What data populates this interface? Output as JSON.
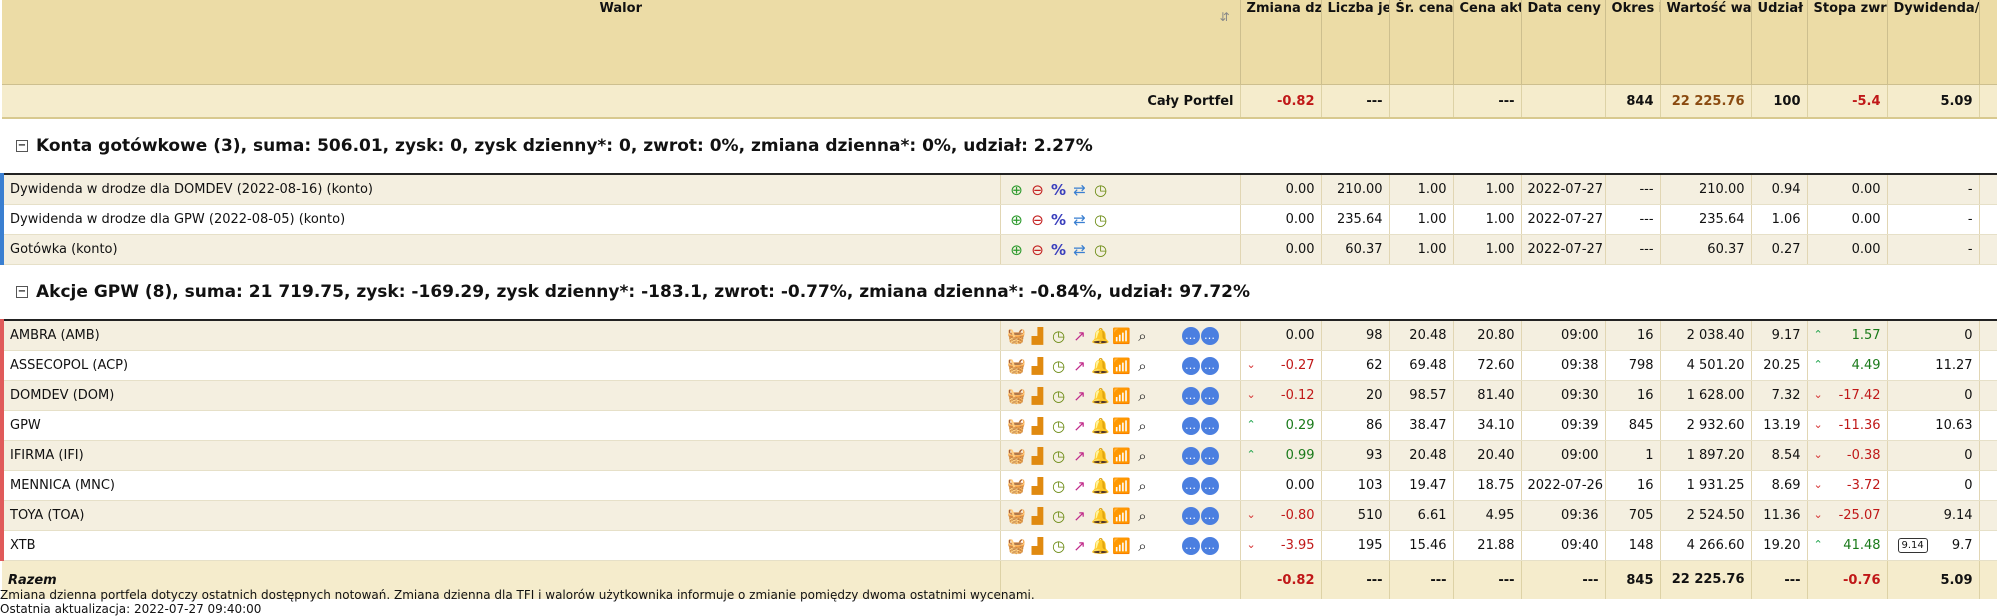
{
  "headers": {
    "walor": "Walor",
    "sort_icon": "⇵",
    "zmiana": "Zmiana dzienna* [%]",
    "liczba": "Liczba jednostek",
    "sr_cena": "Śr. cena zakupu [PLN]",
    "cena_akt": "Cena aktualna [PLN]",
    "data_ceny": "Data ceny aktualnej ***",
    "okres": "Okres inwest. [dni]",
    "wartosc": "Wartość waloru [PLN]",
    "udzial": "Udział waloru [%]",
    "stopa": "Stopa zwrotu [%]",
    "dywidenda": "Dywidenda/ odsetki do ceny zakupu [%]"
  },
  "total": {
    "label": "Cały Portfel",
    "zmiana": "-0.82",
    "liczba": "---",
    "sr_cena": "",
    "cena": "---",
    "data": "",
    "okres": "844",
    "wartosc": "22 225.76",
    "udzial": "100",
    "stopa": "-5.4",
    "dywid": "5.09"
  },
  "sections": {
    "cash": {
      "title": "Konta gotówkowe (3), suma: 506.01, zysk: 0, zysk dzienny*: 0, zwrot: 0%, zmiana dzienna*: 0%, udział: 2.27%",
      "toggle": "−"
    },
    "gpw": {
      "title": "Akcje GPW (8), suma: 21 719.75, zysk: -169.29, zysk dzienny*: -183.1, zwrot: -0.77%, zmiana dzienna*: -0.84%, udział: 97.72%",
      "toggle": "−"
    }
  },
  "cash_rows": [
    {
      "name": "Dywidenda w drodze dla DOMDEV (2022-08-16) (konto)",
      "zmiana": "0.00",
      "liczba": "210.00",
      "sr": "1.00",
      "cena": "1.00",
      "data": "2022-07-27",
      "okres": "---",
      "wartosc": "210.00",
      "udzial": "0.94",
      "stopa": "0.00",
      "dywid": "-"
    },
    {
      "name": "Dywidenda w drodze dla GPW (2022-08-05) (konto)",
      "zmiana": "0.00",
      "liczba": "235.64",
      "sr": "1.00",
      "cena": "1.00",
      "data": "2022-07-27",
      "okres": "---",
      "wartosc": "235.64",
      "udzial": "1.06",
      "stopa": "0.00",
      "dywid": "-"
    },
    {
      "name": "Gotówka (konto)",
      "zmiana": "0.00",
      "liczba": "60.37",
      "sr": "1.00",
      "cena": "1.00",
      "data": "2022-07-27",
      "okres": "---",
      "wartosc": "60.37",
      "udzial": "0.27",
      "stopa": "0.00",
      "dywid": "-"
    }
  ],
  "cash_icons": {
    "add": "⊕",
    "remove": "⊖",
    "pct": "%",
    "transfer": "⇄",
    "clock": "◷"
  },
  "stock_icons": {
    "basket": "🧺",
    "bars": "▟",
    "clock": "◷",
    "trend": "↗",
    "alert": "🔔",
    "signal": "📶",
    "search": "⌕",
    "msg1": "…",
    "msg2": "…"
  },
  "stock_rows": [
    {
      "name": "AMBRA (AMB)",
      "zdir": "",
      "zmiana": "0.00",
      "liczba": "98",
      "sr": "20.48",
      "cena": "20.80",
      "data": "09:00",
      "okres": "16",
      "wartosc": "2 038.40",
      "udzial": "9.17",
      "sdir": "up",
      "stopa": "1.57",
      "dywid": "0"
    },
    {
      "name": "ASSECOPOL (ACP)",
      "zdir": "dn",
      "zmiana": "-0.27",
      "liczba": "62",
      "sr": "69.48",
      "cena": "72.60",
      "data": "09:38",
      "okres": "798",
      "wartosc": "4 501.20",
      "udzial": "20.25",
      "sdir": "up",
      "stopa": "4.49",
      "dywid": "11.27"
    },
    {
      "name": "DOMDEV (DOM)",
      "zdir": "dn",
      "zmiana": "-0.12",
      "liczba": "20",
      "sr": "98.57",
      "cena": "81.40",
      "data": "09:30",
      "okres": "16",
      "wartosc": "1 628.00",
      "udzial": "7.32",
      "sdir": "dn",
      "stopa": "-17.42",
      "dywid": "0"
    },
    {
      "name": "GPW",
      "zdir": "up",
      "zmiana": "0.29",
      "liczba": "86",
      "sr": "38.47",
      "cena": "34.10",
      "data": "09:39",
      "okres": "845",
      "wartosc": "2 932.60",
      "udzial": "13.19",
      "sdir": "dn",
      "stopa": "-11.36",
      "dywid": "10.63"
    },
    {
      "name": "IFIRMA (IFI)",
      "zdir": "up",
      "zmiana": "0.99",
      "liczba": "93",
      "sr": "20.48",
      "cena": "20.40",
      "data": "09:00",
      "okres": "1",
      "wartosc": "1 897.20",
      "udzial": "8.54",
      "sdir": "dn",
      "stopa": "-0.38",
      "dywid": "0"
    },
    {
      "name": "MENNICA (MNC)",
      "zdir": "",
      "zmiana": "0.00",
      "liczba": "103",
      "sr": "19.47",
      "cena": "18.75",
      "data": "2022-07-26",
      "okres": "16",
      "wartosc": "1 931.25",
      "udzial": "8.69",
      "sdir": "dn",
      "stopa": "-3.72",
      "dywid": "0"
    },
    {
      "name": "TOYA (TOA)",
      "zdir": "dn",
      "zmiana": "-0.80",
      "liczba": "510",
      "sr": "6.61",
      "cena": "4.95",
      "data": "09:36",
      "okres": "705",
      "wartosc": "2 524.50",
      "udzial": "11.36",
      "sdir": "dn",
      "stopa": "-25.07",
      "dywid": "9.14"
    },
    {
      "name": "XTB",
      "zdir": "dn",
      "zmiana": "-3.95",
      "liczba": "195",
      "sr": "15.46",
      "cena": "21.88",
      "data": "09:40",
      "okres": "148",
      "wartosc": "4 266.60",
      "udzial": "19.20",
      "sdir": "up",
      "stopa": "41.48",
      "dywid": "9.7",
      "tooltip": "9.14"
    }
  ],
  "arrows": {
    "up": "⌃",
    "dn": "⌄"
  },
  "summary": {
    "label": "Razem",
    "zmiana": "-0.82",
    "liczba": "---",
    "sr": "---",
    "cena": "---",
    "data": "---",
    "okres": "845",
    "wartosc": "22 225.76",
    "udzial": "---",
    "stopa": "-0.76",
    "dywid": "5.09"
  },
  "footer": {
    "line1": "Zmiana dzienna portfela dotyczy ostatnich dostępnych notowań. Zmiana dzienna dla TFI i walorów użytkownika informuje o zmianie pomiędzy dwoma ostatnimi wycenami.",
    "line2": "Ostatnia aktualizacja: 2022-07-27 09:40:00"
  }
}
